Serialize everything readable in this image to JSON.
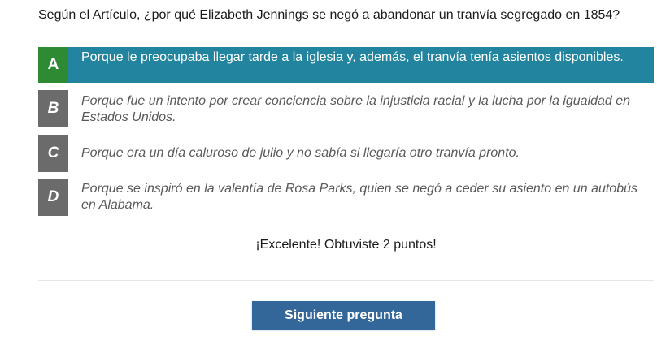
{
  "question": "Según el Artículo, ¿por qué Elizabeth Jennings se negó a abandonar un tranvía segregado en 1854?",
  "options": [
    {
      "letter": "A",
      "text": "Porque le preocupaba llegar tarde a la iglesia y, además, el tranvía tenía asientos disponibles."
    },
    {
      "letter": "B",
      "text": "Porque fue un intento por crear conciencia sobre la injusticia racial y la lucha por la igualdad en Estados Unidos."
    },
    {
      "letter": "C",
      "text": "Porque era un día caluroso de julio y no sabía si llegaría otro tranvía pronto."
    },
    {
      "letter": "D",
      "text": "Porque se inspiró en la valentía de Rosa Parks, quien se negó a ceder su asiento en un autobús en Alabama."
    }
  ],
  "feedback": "¡Excelente! Obtuviste 2 puntos!",
  "next_button": "Siguiente pregunta",
  "colors": {
    "correct_bar": "#22849e",
    "correct_letter": "#2e8b34",
    "letter_default": "#6b6b6b",
    "button": "#336699"
  }
}
